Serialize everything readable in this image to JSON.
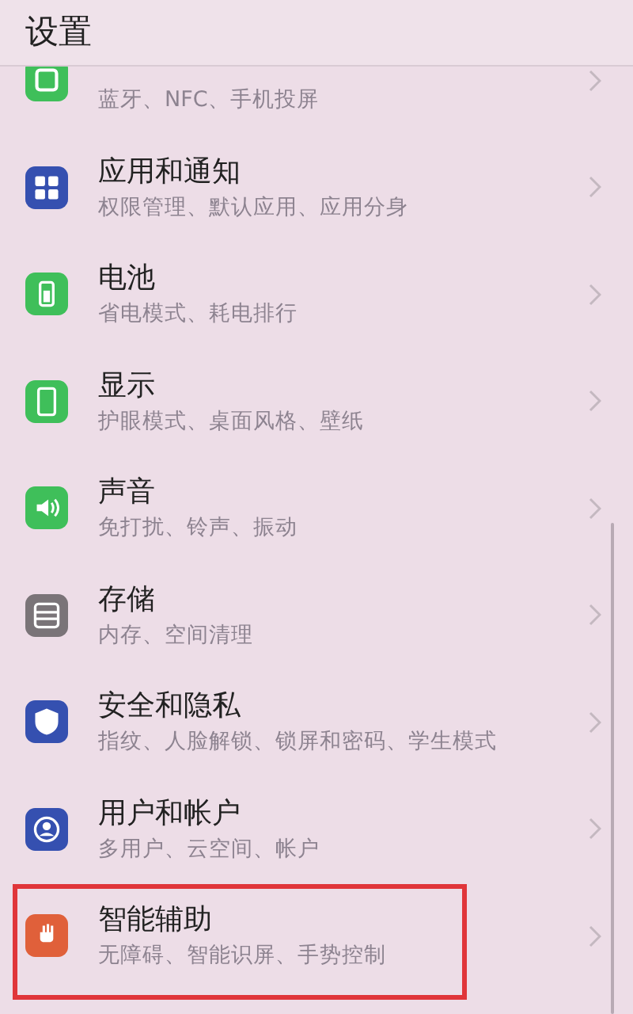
{
  "header": {
    "title": "设置"
  },
  "items": [
    {
      "kind": "connect",
      "subtitle": "蓝牙、NFC、手机投屏",
      "highlighted": false
    },
    {
      "kind": "apps",
      "title": "应用和通知",
      "subtitle": "权限管理、默认应用、应用分身",
      "highlighted": false
    },
    {
      "kind": "battery",
      "title": "电池",
      "subtitle": "省电模式、耗电排行",
      "highlighted": false
    },
    {
      "kind": "display",
      "title": "显示",
      "subtitle": "护眼模式、桌面风格、壁纸",
      "highlighted": false
    },
    {
      "kind": "sound",
      "title": "声音",
      "subtitle": "免打扰、铃声、振动",
      "highlighted": false
    },
    {
      "kind": "storage",
      "title": "存储",
      "subtitle": "内存、空间清理",
      "highlighted": false
    },
    {
      "kind": "security",
      "title": "安全和隐私",
      "subtitle": "指纹、人脸解锁、锁屏和密码、学生模式",
      "highlighted": false
    },
    {
      "kind": "users",
      "title": "用户和帐户",
      "subtitle": "多用户、云空间、帐户",
      "highlighted": false
    },
    {
      "kind": "assist",
      "title": "智能辅助",
      "subtitle": "无障碍、智能识屏、手势控制",
      "highlighted": true
    }
  ]
}
